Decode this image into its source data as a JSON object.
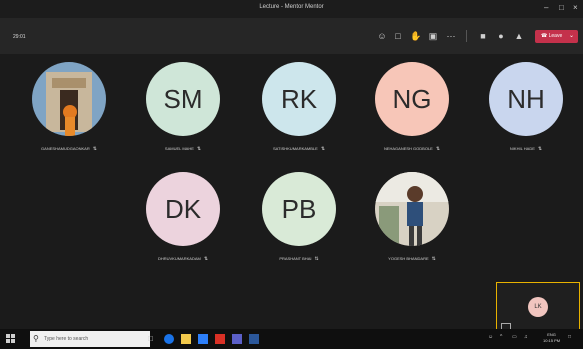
{
  "window": {
    "title": "Lecture - Mentor Mentor"
  },
  "toolbar": {
    "timer": "29:01",
    "leave_label": "Leave"
  },
  "participants": [
    {
      "name": "GANESHAMUDGAONKAR",
      "initials": "",
      "avatar_color": "#6a6a6a"
    },
    {
      "name": "SAMUEL MAHE",
      "initials": "SM",
      "avatar_color": "#cfe6d8"
    },
    {
      "name": "SATISHKUMARKAMBLE",
      "initials": "RK",
      "avatar_color": "#cde6ec"
    },
    {
      "name": "NEHAGANESH GODBOLE",
      "initials": "NG",
      "avatar_color": "#f7c6b8"
    },
    {
      "name": "NIKHIL HADE",
      "initials": "NH",
      "avatar_color": "#c9d6ee"
    },
    {
      "name": "DHRUVKUMARKADAM",
      "initials": "DK",
      "avatar_color": "#ecd3dd"
    },
    {
      "name": "PRASHANT BHAI",
      "initials": "PB",
      "avatar_color": "#d9ead7"
    },
    {
      "name": "YOGESH BHANDARE",
      "initials": "",
      "avatar_color": "#6f6f6f"
    }
  ],
  "self_view": {
    "initials": "LK",
    "color": "#f1c5bf"
  },
  "taskbar": {
    "search_placeholder": "Type here to search",
    "time": "10:15 PM",
    "date": "ENG"
  }
}
